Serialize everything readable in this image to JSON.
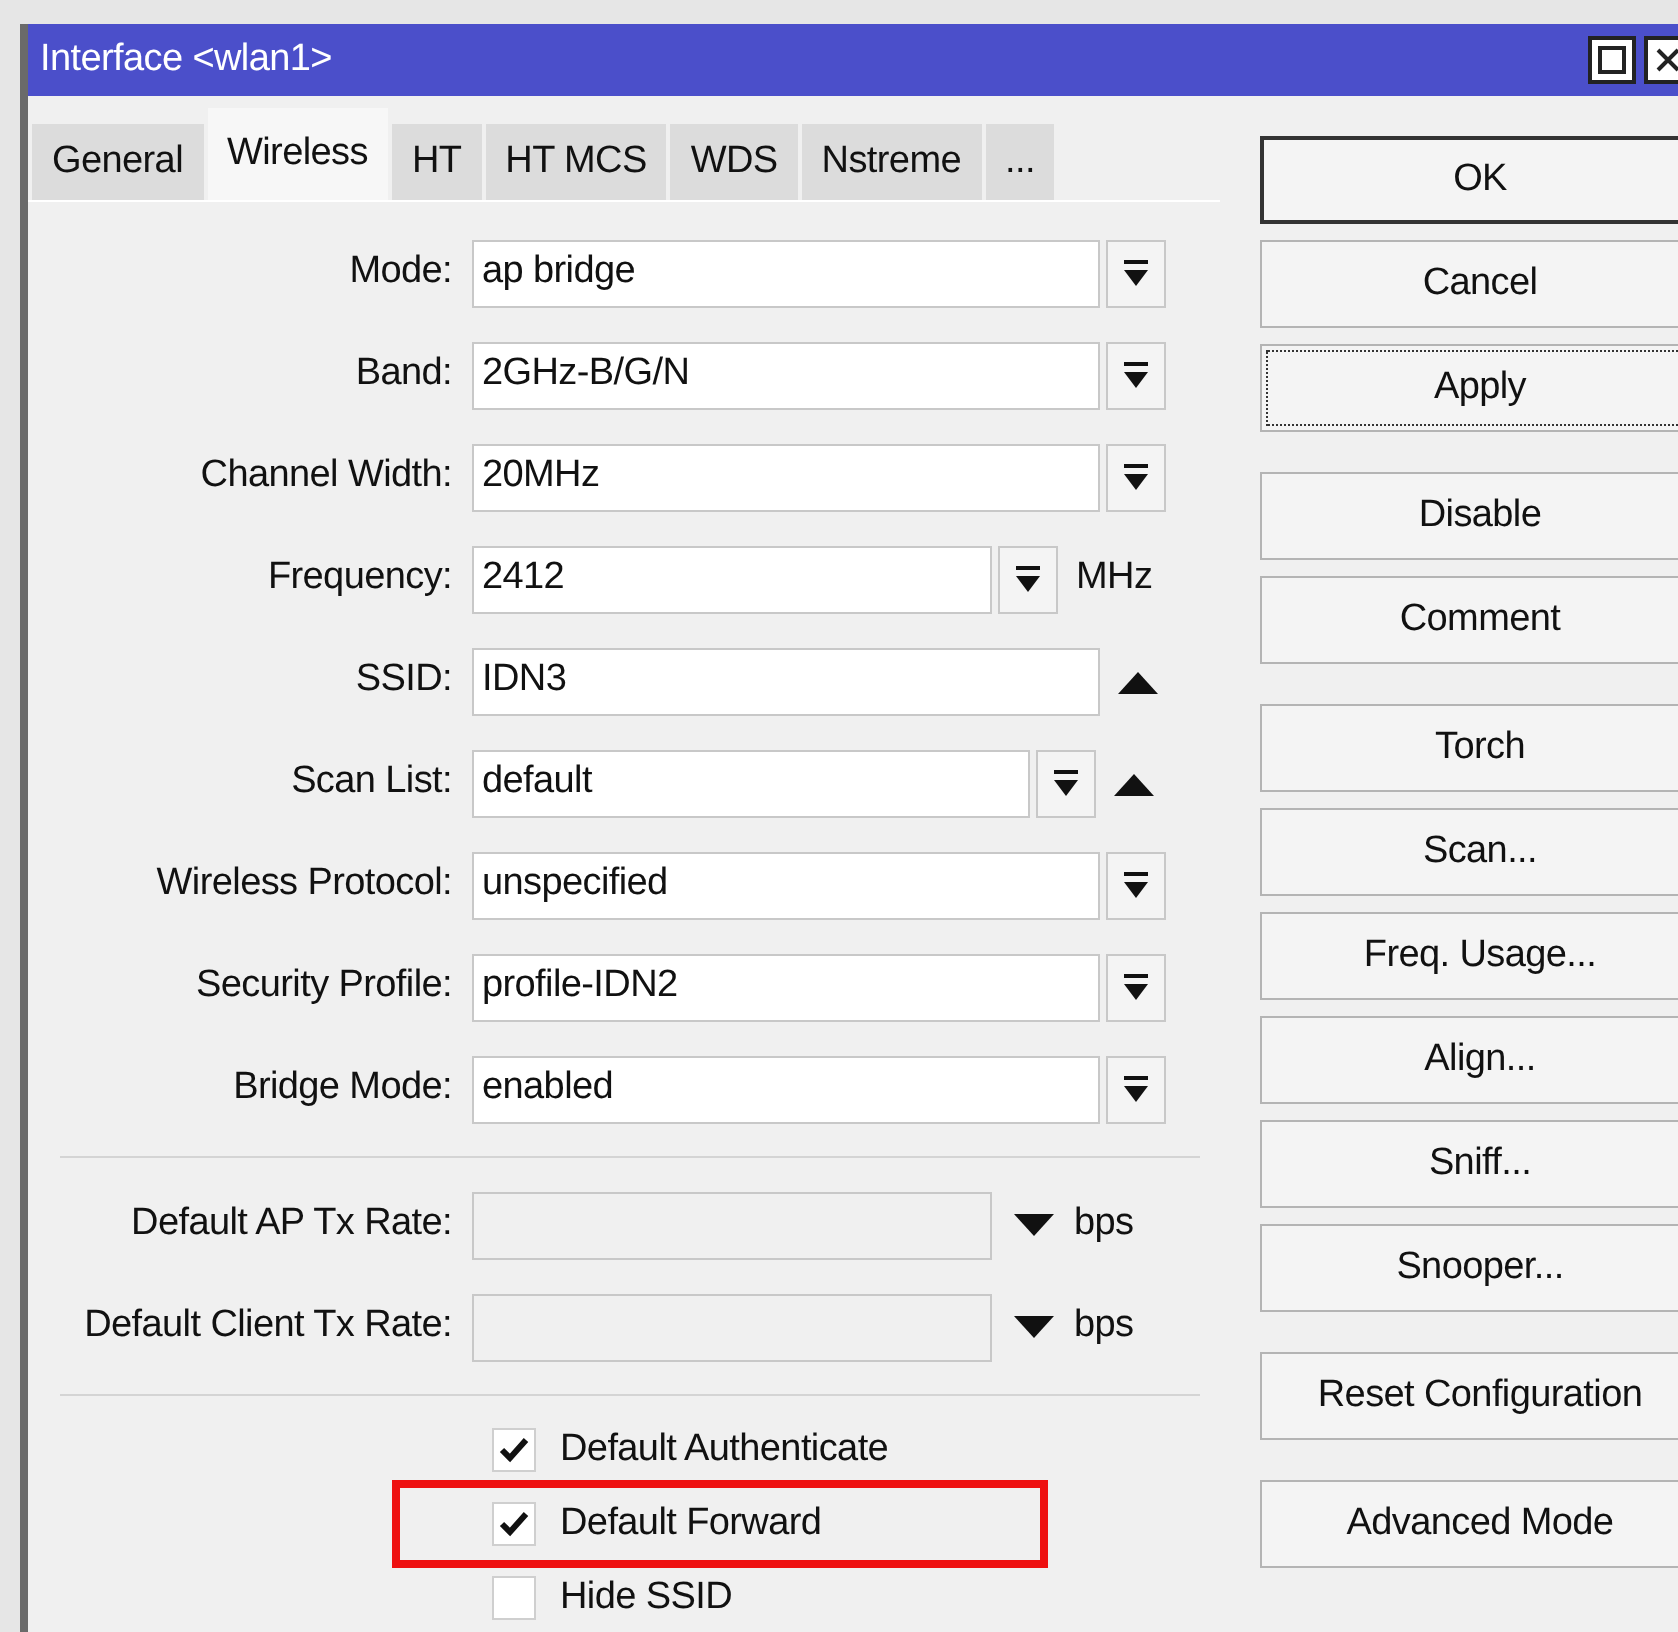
{
  "window": {
    "title": "Interface <wlan1>"
  },
  "tabs": [
    {
      "label": "General",
      "selected": false
    },
    {
      "label": "Wireless",
      "selected": true
    },
    {
      "label": "HT",
      "selected": false
    },
    {
      "label": "HT MCS",
      "selected": false
    },
    {
      "label": "WDS",
      "selected": false
    },
    {
      "label": "Nstreme",
      "selected": false
    },
    {
      "label": "...",
      "selected": false
    }
  ],
  "form_sections": [
    [
      {
        "kind": "select",
        "label": "Mode:",
        "value": "ap bridge"
      },
      {
        "kind": "select",
        "label": "Band:",
        "value": "2GHz-B/G/N"
      },
      {
        "kind": "select",
        "label": "Channel Width:",
        "value": "20MHz"
      },
      {
        "kind": "select_unit",
        "label": "Frequency:",
        "value": "2412",
        "unit": "MHz"
      },
      {
        "kind": "text_collapse",
        "label": "SSID:",
        "value": "IDN3"
      },
      {
        "kind": "select_collapse",
        "label": "Scan List:",
        "value": "default"
      },
      {
        "kind": "select",
        "label": "Wireless Protocol:",
        "value": "unspecified"
      },
      {
        "kind": "select",
        "label": "Security Profile:",
        "value": "profile-IDN2"
      },
      {
        "kind": "select",
        "label": "Bridge Mode:",
        "value": "enabled"
      }
    ],
    [
      {
        "kind": "rate",
        "label": "Default AP Tx Rate:",
        "unit": "bps"
      },
      {
        "kind": "rate",
        "label": "Default Client Tx Rate:",
        "unit": "bps"
      }
    ]
  ],
  "checkboxes": [
    {
      "label": "Default Authenticate",
      "checked": true,
      "highlighted": false
    },
    {
      "label": "Default Forward",
      "checked": true,
      "highlighted": true
    },
    {
      "label": "Hide SSID",
      "checked": false,
      "highlighted": false
    }
  ],
  "button_groups": [
    [
      {
        "label": "OK",
        "focused": false
      },
      {
        "label": "Cancel",
        "focused": false
      },
      {
        "label": "Apply",
        "focused": true
      }
    ],
    [
      {
        "label": "Disable",
        "focused": false
      },
      {
        "label": "Comment",
        "focused": false
      }
    ],
    [
      {
        "label": "Torch",
        "focused": false
      },
      {
        "label": "Scan...",
        "focused": false
      },
      {
        "label": "Freq. Usage...",
        "focused": false
      },
      {
        "label": "Align...",
        "focused": false
      },
      {
        "label": "Sniff...",
        "focused": false
      },
      {
        "label": "Snooper...",
        "focused": false
      }
    ],
    [
      {
        "label": "Reset Configuration",
        "focused": false
      }
    ],
    [
      {
        "label": "Advanced Mode",
        "focused": false
      }
    ]
  ]
}
